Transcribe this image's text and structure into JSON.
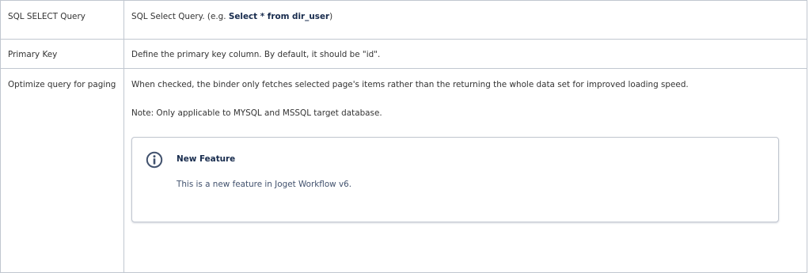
{
  "rows": [
    {
      "name": "SQL SELECT Query",
      "description_prefix": "SQL Select Query. (e.g. ",
      "description_bold": "Select * from dir_user",
      "description_suffix": ")"
    },
    {
      "name": "Primary Key",
      "description": "Define the primary key column. By default, it should be \"id\"."
    },
    {
      "name": "Optimize query for paging",
      "description": "When checked, the binder only fetches selected page's items rather than the returning the whole data set for improved loading speed.",
      "note": "Note: Only applicable to MYSQL and MSSQL target database.",
      "panel": {
        "icon": "info-icon",
        "title": "New Feature",
        "body": "This is a new feature in Joget Workflow v6."
      }
    }
  ],
  "colors": {
    "border": "#c1c7d0",
    "text": "#333333",
    "strong_text": "#172b4d",
    "icon": "#42526e"
  }
}
